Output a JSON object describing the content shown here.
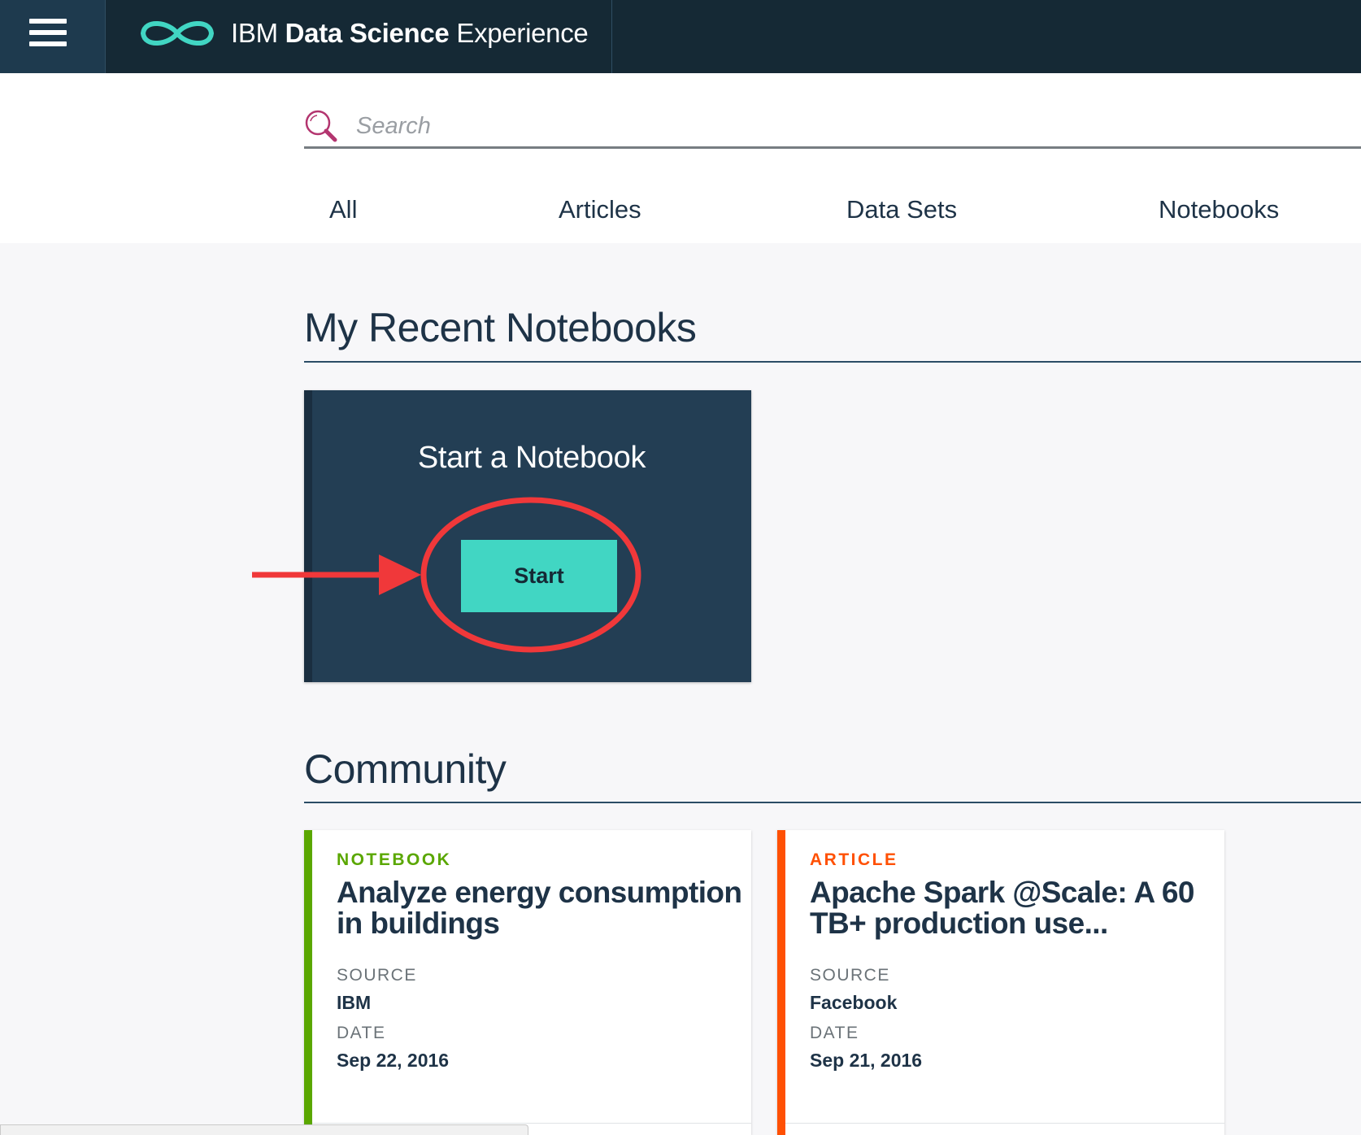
{
  "app": {
    "title_light_1": "IBM ",
    "title_bold": "Data Science",
    "title_light_2": " Experience",
    "accent": "#41d6c3",
    "header_bg": "#152935"
  },
  "header": {
    "menu_icon": "hamburger-menu-icon",
    "logo_icon": "infinity-logo-icon"
  },
  "search": {
    "placeholder": "Search",
    "value": "",
    "icon": "search-icon"
  },
  "tabs": [
    {
      "label": "All"
    },
    {
      "label": "Articles"
    },
    {
      "label": "Data Sets"
    },
    {
      "label": "Notebooks"
    }
  ],
  "recent": {
    "title": "My Recent Notebooks",
    "start_card": {
      "title": "Start a Notebook",
      "button_label": "Start"
    }
  },
  "community": {
    "title": "Community",
    "cards": [
      {
        "type": "NOTEBOOK",
        "type_color": "#5aa700",
        "title": "Analyze energy consumption in buildings",
        "source_label": "SOURCE",
        "source": "IBM",
        "date_label": "DATE",
        "date": "Sep 22, 2016"
      },
      {
        "type": "ARTICLE",
        "type_color": "#ff5003",
        "title": "Apache Spark @Scale: A 60 TB+ production use...",
        "source_label": "SOURCE",
        "source": "Facebook",
        "date_label": "DATE",
        "date": "Sep 21, 2016"
      }
    ]
  },
  "annotation": {
    "color": "#f0383a",
    "shapes": [
      "red-arrow",
      "red-ellipse"
    ]
  }
}
